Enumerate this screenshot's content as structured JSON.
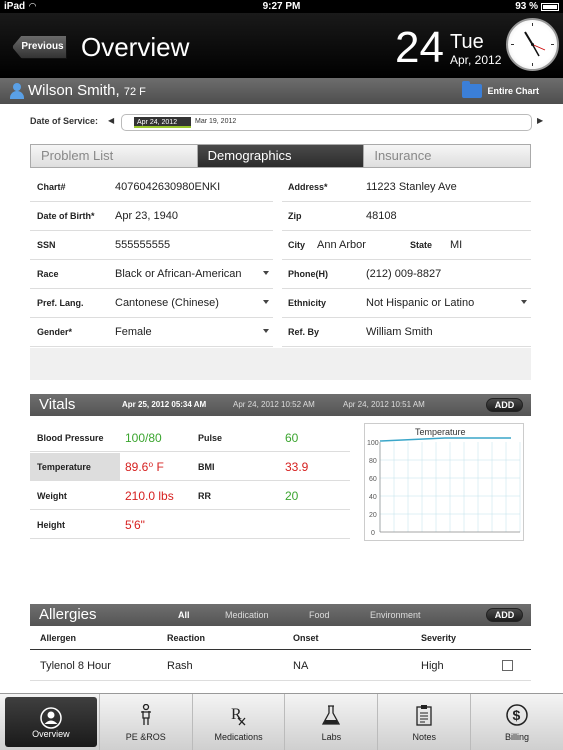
{
  "status": {
    "device": "iPad",
    "time": "9:27 PM",
    "battery": "93 %"
  },
  "header": {
    "previous_label": "Previous",
    "title": "Overview",
    "day": "24",
    "weekday": "Tue",
    "month_year": "Apr, 2012"
  },
  "patient": {
    "name": "Wilson Smith,",
    "info": "72 F",
    "entire_chart_label": "Entire Chart"
  },
  "date_of_service": {
    "label": "Date of Service:",
    "selected": "Apr 24, 2012",
    "next": "Mar 19, 2012"
  },
  "tabs": [
    {
      "label": "Problem List",
      "active": false
    },
    {
      "label": "Demographics",
      "active": true
    },
    {
      "label": "Insurance",
      "active": false
    }
  ],
  "demographics": {
    "chart_label": "Chart#",
    "chart_value": "4076042630980ENKI",
    "dob_label": "Date of Birth*",
    "dob_value": "Apr 23, 1940",
    "ssn_label": "SSN",
    "ssn_value": "555555555",
    "race_label": "Race",
    "race_value": "Black or African-American",
    "lang_label": "Pref. Lang.",
    "lang_value": "Cantonese (Chinese)",
    "gender_label": "Gender*",
    "gender_value": "Female",
    "address_label": "Address*",
    "address_value": "11223 Stanley Ave",
    "zip_label": "Zip",
    "zip_value": "48108",
    "city_label": "City",
    "city_value": "Ann Arbor",
    "state_label": "State",
    "state_value": "MI",
    "phone_label": "Phone(H)",
    "phone_value": "(212) 009-8827",
    "ethnicity_label": "Ethnicity",
    "ethnicity_value": "Not Hispanic or Latino",
    "refby_label": "Ref. By",
    "refby_value": "William Smith"
  },
  "vitals": {
    "title": "Vitals",
    "add_label": "ADD",
    "dates": [
      "Apr 25, 2012 05:34 AM",
      "Apr 24, 2012 10:52 AM",
      "Apr 24, 2012 10:51 AM"
    ],
    "bp_label": "Blood Pressure",
    "bp_value": "100/80",
    "pulse_label": "Pulse",
    "pulse_value": "60",
    "temp_label": "Temperature",
    "temp_value": "89.6⁰ F",
    "bmi_label": "BMI",
    "bmi_value": "33.9",
    "weight_label": "Weight",
    "weight_value": "210.0 lbs",
    "rr_label": "RR",
    "rr_value": "20",
    "height_label": "Height",
    "height_value": "5'6\""
  },
  "temperature_chart": {
    "title": "Temperature",
    "y_ticks": [
      "100",
      "80",
      "60",
      "40",
      "20",
      "0"
    ],
    "line_color": "#3aa6c9"
  },
  "allergies": {
    "title": "Allergies",
    "add_label": "ADD",
    "filters": [
      "All",
      "Medication",
      "Food",
      "Environment"
    ],
    "headers": [
      "Allergen",
      "Reaction",
      "Onset",
      "Severity"
    ],
    "rows": [
      {
        "allergen": "Tylenol 8 Hour",
        "reaction": "Rash",
        "onset": "NA",
        "severity": "High"
      }
    ]
  },
  "tabbar": [
    {
      "label": "Overview",
      "icon": "person-circle-icon",
      "active": true
    },
    {
      "label": "PE &ROS",
      "icon": "body-icon",
      "active": false
    },
    {
      "label": "Medications",
      "icon": "rx-icon",
      "active": false
    },
    {
      "label": "Labs",
      "icon": "flask-icon",
      "active": false
    },
    {
      "label": "Notes",
      "icon": "clipboard-icon",
      "active": false
    },
    {
      "label": "Billing",
      "icon": "dollar-icon",
      "active": false
    }
  ]
}
